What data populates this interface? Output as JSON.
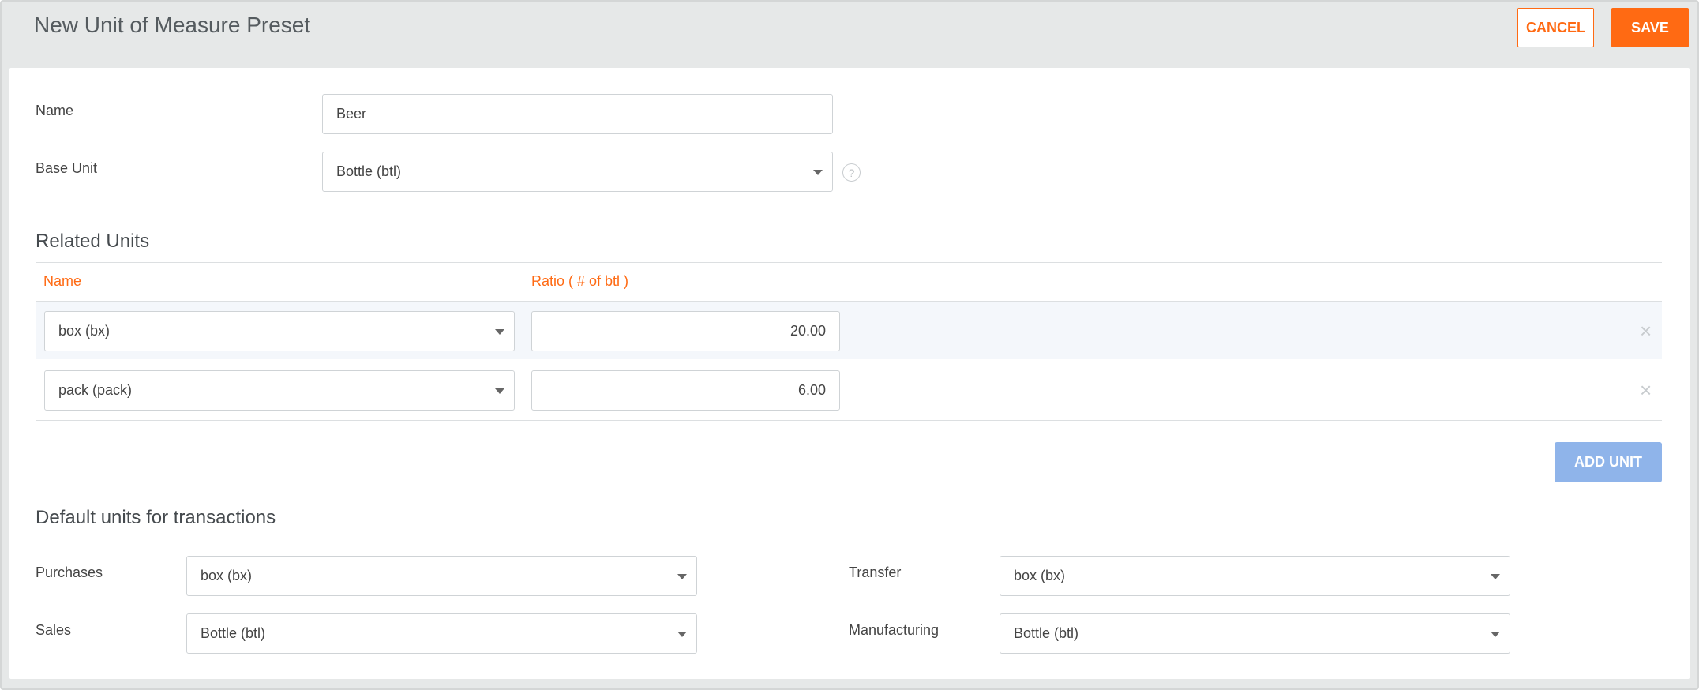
{
  "header": {
    "title": "New Unit of Measure Preset",
    "cancel_label": "CANCEL",
    "save_label": "SAVE"
  },
  "form": {
    "name_label": "Name",
    "name_value": "Beer",
    "base_unit_label": "Base Unit",
    "base_unit_value": "Bottle (btl)",
    "help_glyph": "?"
  },
  "related_units": {
    "title": "Related Units",
    "col_name": "Name",
    "col_ratio": "Ratio ( # of btl )",
    "rows": [
      {
        "unit": "box (bx)",
        "ratio": "20.00"
      },
      {
        "unit": "pack (pack)",
        "ratio": "6.00"
      }
    ],
    "remove_glyph": "×",
    "add_label": "ADD UNIT"
  },
  "defaults": {
    "title": "Default units for transactions",
    "purchases_label": "Purchases",
    "purchases_value": "box (bx)",
    "sales_label": "Sales",
    "sales_value": "Bottle (btl)",
    "transfer_label": "Transfer",
    "transfer_value": "box (bx)",
    "manufacturing_label": "Manufacturing",
    "manufacturing_value": "Bottle (btl)"
  },
  "colors": {
    "accent": "#ff6a13",
    "add_button": "#8fb4ea",
    "row_highlight": "#f4f7fb"
  }
}
